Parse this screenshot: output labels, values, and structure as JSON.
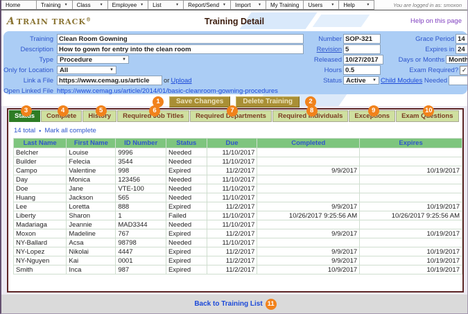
{
  "menu": {
    "items": [
      {
        "label": "Home",
        "dropdown": false
      },
      {
        "label": "Training",
        "dropdown": true
      },
      {
        "label": "Class",
        "dropdown": true
      },
      {
        "label": "Employee",
        "dropdown": true
      },
      {
        "label": "List",
        "dropdown": true
      },
      {
        "label": "Report/Send",
        "dropdown": true
      },
      {
        "label": "Import",
        "dropdown": true
      },
      {
        "label": "My Training",
        "dropdown": false
      },
      {
        "label": "Users",
        "dropdown": true
      },
      {
        "label": "Help",
        "dropdown": true
      }
    ],
    "logged_in_text": "You are logged in as: smoxon"
  },
  "header": {
    "logo_a": "A",
    "logo_text": "TRAIN TRACK",
    "logo_reg": "®",
    "page_title": "Training Detail",
    "help_link": "Help on this page"
  },
  "form": {
    "left": {
      "training_label": "Training",
      "training_value": "Clean Room Gowning",
      "description_label": "Description",
      "description_value": "How to gown for entry into the clean room",
      "type_label": "Type",
      "type_value": "Procedure",
      "location_label": "Only for Location",
      "location_value": "All",
      "link_file_label": "Link a File",
      "link_file_value": "https://www.cemag.us/article",
      "or_text": "or",
      "upload_link": "Upload",
      "open_linked_label": "Open Linked File",
      "open_linked_url": "https://www.cemag.us/article/2014/01/basic-cleanroom-gowning-procedures"
    },
    "right": {
      "number_label": "Number",
      "number_value": "SOP-321",
      "grace_label": "Grace Period",
      "grace_value": "14",
      "revision_link": "Revision",
      "revision_value": "5",
      "expires_label": "Expires in",
      "expires_value": "24",
      "released_label": "Released",
      "released_value": "10/27/2017",
      "days_months_label": "Days or Months",
      "days_months_value": "Months",
      "hours_label": "Hours",
      "hours_value": "0.5",
      "exam_label": "Exam Required?",
      "exam_checked": true,
      "status_label": "Status",
      "status_value": "Active",
      "child_modules_link": "Child Modules",
      "needed_label": "Needed",
      "needed_value": ""
    }
  },
  "actions": {
    "save_label": "Save Changes",
    "delete_label": "Delete Training"
  },
  "tabs": [
    {
      "label": "Status",
      "active": true
    },
    {
      "label": "Complete",
      "active": false
    },
    {
      "label": "History",
      "active": false
    },
    {
      "label": "Required Job Titles",
      "active": false
    },
    {
      "label": "Required Departments",
      "active": false
    },
    {
      "label": "Required Individuals",
      "active": false
    },
    {
      "label": "Exceptions",
      "active": false
    },
    {
      "label": "Exam Questions",
      "active": false
    }
  ],
  "status_panel": {
    "total_text": "14 total",
    "separator": "•",
    "mark_all_link": "Mark all complete",
    "table": {
      "headers": [
        "Last Name",
        "First Name",
        "ID Number",
        "Status",
        "Due",
        "Completed",
        "Expires"
      ],
      "rows": [
        [
          "Belcher",
          "Louise",
          "9996",
          "Needed",
          "11/10/2017",
          "",
          ""
        ],
        [
          "Builder",
          "Felecia",
          "3544",
          "Needed",
          "11/10/2017",
          "",
          ""
        ],
        [
          "Campo",
          "Valentine",
          "998",
          "Expired",
          "11/2/2017",
          "9/9/2017",
          "10/19/2017"
        ],
        [
          "Day",
          "Monica",
          "123456",
          "Needed",
          "11/10/2017",
          "",
          ""
        ],
        [
          "Doe",
          "Jane",
          "VTE-100",
          "Needed",
          "11/10/2017",
          "",
          ""
        ],
        [
          "Huang",
          "Jackson",
          "565",
          "Needed",
          "11/10/2017",
          "",
          ""
        ],
        [
          "Lee",
          "Loretta",
          "888",
          "Expired",
          "11/2/2017",
          "9/9/2017",
          "10/19/2017"
        ],
        [
          "Liberty",
          "Sharon",
          "1",
          "Failed",
          "11/10/2017",
          "10/26/2017 9:25:56 AM",
          "10/26/2017 9:25:56 AM"
        ],
        [
          "Madariaga",
          "Jeannie",
          "MAD3344",
          "Needed",
          "11/10/2017",
          "",
          ""
        ],
        [
          "Moxon",
          "Madeline",
          "767",
          "Expired",
          "11/2/2017",
          "9/9/2017",
          "10/19/2017"
        ],
        [
          "NY-Ballard",
          "Acsa",
          "98798",
          "Needed",
          "11/10/2017",
          "",
          ""
        ],
        [
          "NY-Lopez",
          "Nikolai",
          "4447",
          "Expired",
          "11/2/2017",
          "9/9/2017",
          "10/19/2017"
        ],
        [
          "NY-Nguyen",
          "Kai",
          "0001",
          "Expired",
          "11/2/2017",
          "9/9/2017",
          "10/19/2017"
        ],
        [
          "Smith",
          "Inca",
          "987",
          "Expired",
          "11/2/2017",
          "10/9/2017",
          "10/19/2017"
        ]
      ]
    }
  },
  "footer": {
    "back_link": "Back to Training List"
  },
  "callouts": [
    "1",
    "2",
    "3",
    "4",
    "5",
    "6",
    "7",
    "8",
    "9",
    "10",
    "11"
  ],
  "colors": {
    "callout_orange": "#f1821b",
    "tab_active_green": "#2e7d25",
    "tab_green": "#cfe0a0",
    "table_header_green": "#7ec57e",
    "form_panel_blue": "#abcdf5",
    "link_blue": "#1b49d8",
    "label_blue": "#2e55cc",
    "panel_border_maroon": "#5d2626",
    "button_gold": "#a98f35"
  }
}
